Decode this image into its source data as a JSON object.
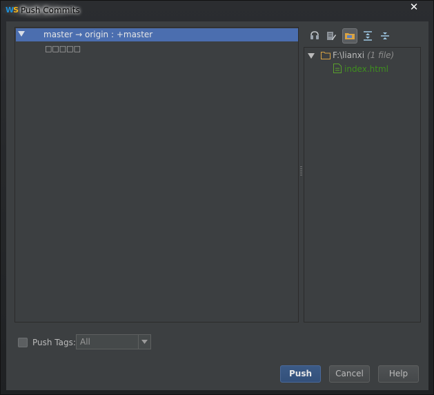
{
  "window": {
    "title": "Push Commits",
    "close_glyph": "✕"
  },
  "commits": {
    "branch_label": "master → origin : +master",
    "commit_message": "□□□□□"
  },
  "toolbar": {
    "icons": [
      "show-diff-icon",
      "edit-source-icon",
      "group-by-directory-icon",
      "expand-all-icon",
      "collapse-all-icon"
    ],
    "active_index": 2
  },
  "changes": {
    "folder_path": "F:\\lianxi",
    "folder_count": "(1 file)",
    "file_name": "index.html"
  },
  "options": {
    "push_tags_label": "Push Tags:",
    "push_tags_checked": false,
    "tags_value": "All"
  },
  "buttons": {
    "push": "Push",
    "cancel": "Cancel",
    "help": "Help"
  },
  "colors": {
    "selection": "#4b6eaf",
    "modified_file": "#3f8f1f",
    "background": "#3c3f41"
  }
}
